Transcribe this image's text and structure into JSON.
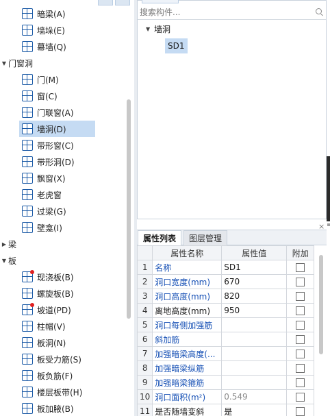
{
  "left_tree": {
    "rows": [
      {
        "type": "item",
        "label": "暗梁(A)",
        "icon": "concealed-beam-icon"
      },
      {
        "type": "item",
        "label": "墙垛(E)",
        "icon": "wall-pier-icon"
      },
      {
        "type": "item",
        "label": "幕墙(Q)",
        "icon": "curtain-wall-icon"
      },
      {
        "type": "cat",
        "label": "门窗洞",
        "expanded": true
      },
      {
        "type": "item",
        "label": "门(M)",
        "icon": "door-icon"
      },
      {
        "type": "item",
        "label": "窗(C)",
        "icon": "window-icon"
      },
      {
        "type": "item",
        "label": "门联窗(A)",
        "icon": "door-window-icon"
      },
      {
        "type": "item",
        "label": "墙洞(D)",
        "icon": "wall-opening-icon",
        "selected": true
      },
      {
        "type": "item",
        "label": "带形窗(C)",
        "icon": "strip-window-icon"
      },
      {
        "type": "item",
        "label": "带形洞(D)",
        "icon": "strip-opening-icon"
      },
      {
        "type": "item",
        "label": "飘窗(X)",
        "icon": "bay-window-icon"
      },
      {
        "type": "item",
        "label": "老虎窗",
        "icon": "dormer-window-icon"
      },
      {
        "type": "item",
        "label": "过梁(G)",
        "icon": "lintel-icon"
      },
      {
        "type": "item",
        "label": "壁龛(I)",
        "icon": "niche-icon"
      },
      {
        "type": "cat",
        "label": "梁",
        "expanded": false
      },
      {
        "type": "cat",
        "label": "板",
        "expanded": true
      },
      {
        "type": "item",
        "label": "现浇板(B)",
        "icon": "cast-slab-icon",
        "dot": true
      },
      {
        "type": "item",
        "label": "螺旋板(B)",
        "icon": "spiral-slab-icon"
      },
      {
        "type": "item",
        "label": "坡道(PD)",
        "icon": "ramp-icon",
        "dot": true
      },
      {
        "type": "item",
        "label": "柱帽(V)",
        "icon": "column-cap-icon"
      },
      {
        "type": "item",
        "label": "板洞(N)",
        "icon": "slab-opening-icon"
      },
      {
        "type": "item",
        "label": "板受力筋(S)",
        "icon": "slab-stress-rebar-icon"
      },
      {
        "type": "item",
        "label": "板负筋(F)",
        "icon": "slab-negative-rebar-icon"
      },
      {
        "type": "item",
        "label": "楼层板带(H)",
        "icon": "floor-slab-strip-icon"
      },
      {
        "type": "item",
        "label": "板加腋(B)",
        "icon": "slab-haunch-icon"
      }
    ]
  },
  "component_panel": {
    "search_placeholder": "搜索构件...",
    "tree_root": "墙洞",
    "tree_leaf": "SD1"
  },
  "properties": {
    "close_glyph": "×",
    "tabs": [
      "属性列表",
      "图层管理"
    ],
    "columns": [
      "属性名称",
      "属性值",
      "附加"
    ],
    "rows": [
      {
        "idx": "1",
        "name": "名称",
        "value": "SD1",
        "name_color": "blue",
        "value_grey": false
      },
      {
        "idx": "2",
        "name": "洞口宽度(mm)",
        "value": "670",
        "name_color": "blue",
        "value_grey": false
      },
      {
        "idx": "3",
        "name": "洞口高度(mm)",
        "value": "820",
        "name_color": "blue",
        "value_grey": false
      },
      {
        "idx": "4",
        "name": "离地高度(mm)",
        "value": "950",
        "name_color": "black",
        "value_grey": false
      },
      {
        "idx": "5",
        "name": "洞口每侧加强筋",
        "value": "",
        "name_color": "blue",
        "value_grey": false
      },
      {
        "idx": "6",
        "name": "斜加筋",
        "value": "",
        "name_color": "blue",
        "value_grey": false
      },
      {
        "idx": "7",
        "name": "加强暗梁高度(...",
        "value": "",
        "name_color": "blue",
        "value_grey": false
      },
      {
        "idx": "8",
        "name": "加强暗梁纵筋",
        "value": "",
        "name_color": "blue",
        "value_grey": false
      },
      {
        "idx": "9",
        "name": "加强暗梁箍筋",
        "value": "",
        "name_color": "blue",
        "value_grey": false
      },
      {
        "idx": "10",
        "name": "洞口面积(m²)",
        "value": "0.549",
        "name_color": "blue",
        "value_grey": true
      },
      {
        "idx": "11",
        "name": "是否随墙变斜",
        "value": "是",
        "name_color": "black",
        "value_grey": false
      }
    ]
  }
}
